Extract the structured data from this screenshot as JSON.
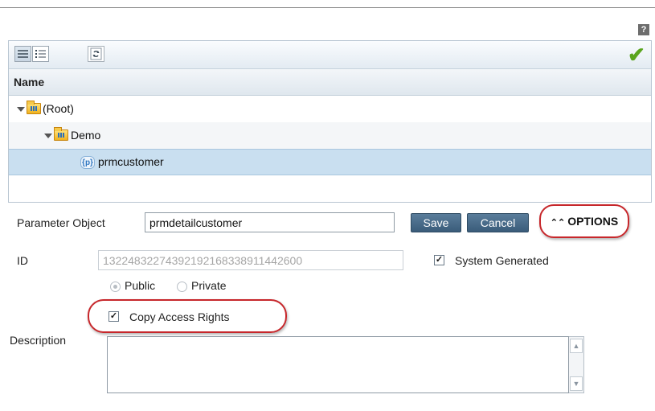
{
  "help": {
    "label": "?"
  },
  "tree": {
    "header": "Name",
    "nodes": [
      {
        "label": "(Root)",
        "icon": "folder-icon",
        "expanded": true,
        "level": 0
      },
      {
        "label": "Demo",
        "icon": "folder-icon",
        "expanded": true,
        "level": 1
      },
      {
        "label": "prmcustomer",
        "icon": "parameter-object-icon",
        "selected": true,
        "level": 2
      }
    ]
  },
  "form": {
    "parameter_object_label": "Parameter Object",
    "parameter_object_value": "prmdetailcustomer",
    "save_label": "Save",
    "cancel_label": "Cancel",
    "options_label": "OPTIONS",
    "id_label": "ID",
    "id_value": "13224832274392192168338911442600",
    "system_generated_label": "System Generated",
    "system_generated_checked": true,
    "public_label": "Public",
    "private_label": "Private",
    "visibility_selected": "Public",
    "copy_access_rights_label": "Copy Access Rights",
    "copy_access_rights_checked": true,
    "description_label": "Description",
    "description_value": ""
  },
  "colors": {
    "selected_row": "#c9dff0",
    "button": "#3a5c7a",
    "highlight_ring": "#c7272b",
    "confirm_check": "#5aa51e"
  }
}
